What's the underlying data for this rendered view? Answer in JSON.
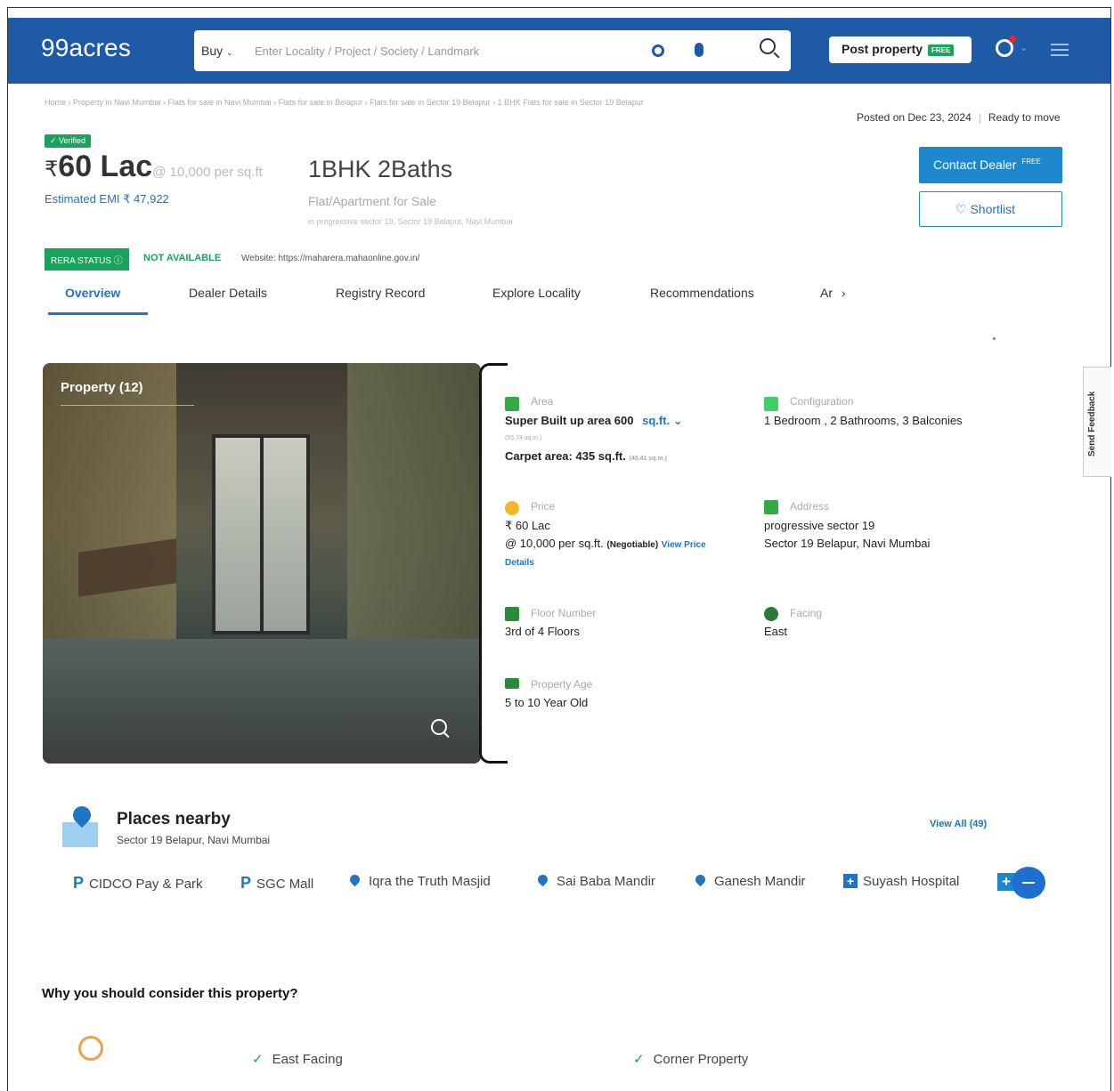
{
  "header": {
    "logo": "99acres",
    "buy_label": "Buy",
    "search_placeholder": "Enter Locality / Project / Society / Landmark",
    "post_property_label": "Post property",
    "free_tag": "FREE"
  },
  "breadcrumb": "Home › Property in Navi Mumbai › Flats for sale in Navi Mumbai › Flats for sale in Belapur › Flats for sale in Sector 19 Belapur › 1 BHK Flats for sale in Sector 19 Belapur",
  "posted": {
    "date": "Posted on Dec 23, 2024",
    "status": "Ready to move"
  },
  "listing": {
    "verified": "✓ Verified",
    "currency": "₹",
    "price": "60 Lac",
    "per_sqft": "@ 10,000 per sq.ft",
    "emi": "Estimated EMI ₹ 47,922",
    "title": "1BHK 2Baths",
    "type": "Flat/Apartment for Sale",
    "address": "in progressive sector 19, Sector 19 Belapur, Navi Mumbai"
  },
  "actions": {
    "contact": "Contact Dealer",
    "contact_tag": "FREE",
    "shortlist": "♡  Shortlist"
  },
  "rera": {
    "status_label": "RERA STATUS",
    "value": "NOT AVAILABLE",
    "website": "Website: https://maharera.mahaonline.gov.in/"
  },
  "tabs": [
    "Overview",
    "Dealer Details",
    "Registry Record",
    "Explore Locality",
    "Recommendations",
    "Ar"
  ],
  "feedback": "Send Feedback",
  "photo": {
    "title": "Property (12)"
  },
  "details": {
    "area": {
      "label": "Area",
      "super": "Super Built up area 600",
      "unit": "sq.ft.",
      "super_sqm": "(55.74 sq.m.)",
      "carpet": "Carpet area: 435 sq.ft.",
      "carpet_sqm": "(40.41 sq.m.)"
    },
    "config": {
      "label": "Configuration",
      "value": "1 Bedroom , 2 Bathrooms, 3 Balconies"
    },
    "price": {
      "label": "Price",
      "value": "₹ 60 Lac",
      "per": "@ 10,000 per sq.ft.",
      "negotiable": "(Negotiable)",
      "view": "View Price",
      "details": "Details"
    },
    "address": {
      "label": "Address",
      "line1": "progressive sector 19",
      "line2": "Sector 19 Belapur, Navi Mumbai"
    },
    "floor": {
      "label": "Floor Number",
      "value": "3rd  of 4 Floors"
    },
    "facing": {
      "label": "Facing",
      "value": "East"
    },
    "age": {
      "label": "Property Age",
      "value": "5 to 10 Year Old"
    }
  },
  "places": {
    "title": "Places nearby",
    "subtitle": "Sector 19 Belapur, Navi Mumbai",
    "view_all": "View All (49)",
    "items": [
      "CIDCO Pay & Park",
      "SGC Mall",
      "Iqra the Truth Masjid",
      "Sai Baba Mandir",
      "Ganesh Mandir",
      "Suyash Hospital"
    ]
  },
  "why": {
    "title": "Why you should consider this property?",
    "features": [
      "East Facing",
      "Corner Property"
    ]
  }
}
